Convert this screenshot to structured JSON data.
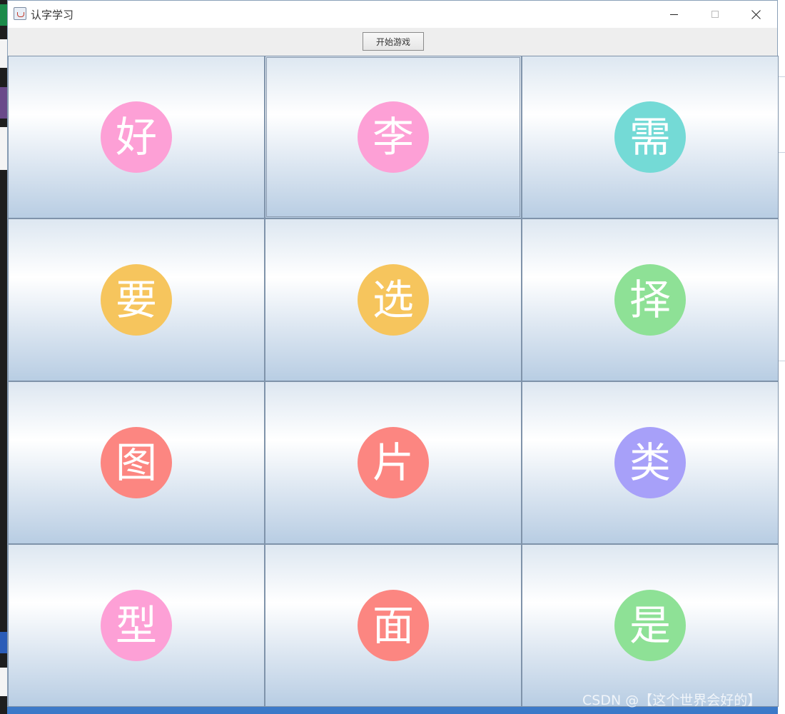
{
  "window": {
    "title": "认字学习"
  },
  "toolbar": {
    "start_label": "开始游戏"
  },
  "cells": [
    {
      "char": "好",
      "color": "#fda0d6"
    },
    {
      "char": "李",
      "color": "#fda0d6"
    },
    {
      "char": "需",
      "color": "#74dad6"
    },
    {
      "char": "要",
      "color": "#f6c55d"
    },
    {
      "char": "选",
      "color": "#f6c55d"
    },
    {
      "char": "择",
      "color": "#8ee196"
    },
    {
      "char": "图",
      "color": "#fc8681"
    },
    {
      "char": "片",
      "color": "#fc8681"
    },
    {
      "char": "类",
      "color": "#a7a0f9"
    },
    {
      "char": "型",
      "color": "#fda0d6"
    },
    {
      "char": "面",
      "color": "#fc8681"
    },
    {
      "char": "是",
      "color": "#8ee196"
    }
  ],
  "watermark": "CSDN @【这个世界会好的】",
  "icons": {
    "app": "java-coffee-icon",
    "minimize": "minimize-icon",
    "maximize": "maximize-icon",
    "close": "close-icon"
  }
}
